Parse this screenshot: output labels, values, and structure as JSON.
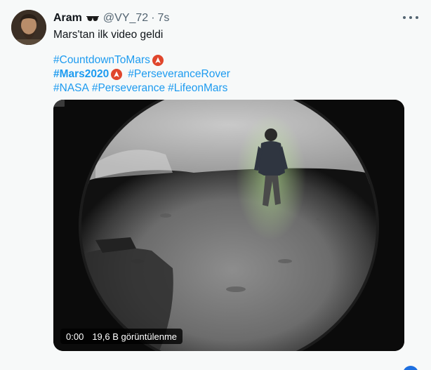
{
  "tweet": {
    "display_name": "Aram",
    "handle": "@VY_72",
    "separator": "·",
    "time": "7s",
    "text": "Mars'tan ilk video geldi",
    "hashtags": {
      "line1": [
        "#CountdownToMars"
      ],
      "line2": [
        "#Mars2020",
        "#PerseveranceRover"
      ],
      "line3": [
        "#NASA",
        "#Perseverance",
        "#LifeonMars"
      ]
    },
    "video": {
      "timestamp": "0:00",
      "views": "19,6 B görüntülenme"
    }
  },
  "colors": {
    "link": "#1d9bf0",
    "badge": "#e0462c",
    "muted": "#536471",
    "card_bg": "#f7f9f9"
  },
  "icons": [
    "sunglasses-icon",
    "more-icon",
    "mars-badge-icon",
    "fullscreen-icon"
  ]
}
